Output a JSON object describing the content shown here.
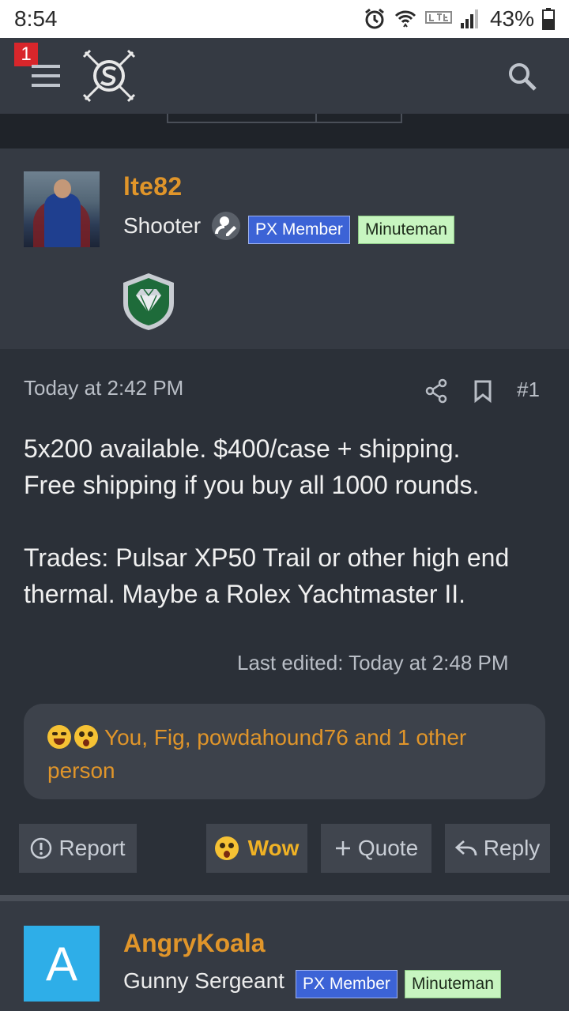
{
  "status_bar": {
    "time": "8:54",
    "battery": "43%",
    "icons": [
      "alarm-icon",
      "wifi-icon",
      "lte-icon",
      "signal-icon",
      "battery-icon"
    ]
  },
  "header": {
    "notification_count": "1",
    "icons": [
      "menu-icon",
      "site-logo",
      "search-icon"
    ]
  },
  "post1": {
    "user": {
      "name": "lte82",
      "title": "Shooter",
      "badges": [
        "PX Member",
        "Minuteman"
      ]
    },
    "date": "Today at 2:42 PM",
    "number": "#1",
    "text_lines": [
      "5x200 available. $400/case + shipping.",
      "Free shipping if you buy all 1000 rounds.",
      "Trades: Pulsar XP50 Trail or other high end",
      "thermal. Maybe a Rolex Yachtmaster II."
    ],
    "last_edited": "Last edited: Today at 2:48 PM",
    "reactions_text": "You, Fig, powdahound76 and 1 other person",
    "buttons": {
      "report": "Report",
      "wow": "Wow",
      "quote": "Quote",
      "reply": "Reply"
    }
  },
  "post2": {
    "user": {
      "avatar_letter": "A",
      "name": "AngryKoala",
      "title": "Gunny Sergeant",
      "badges": [
        "PX Member",
        "Minuteman"
      ]
    }
  },
  "colors": {
    "background": "#2b3038",
    "panel": "#353a43",
    "accent_username": "#e0952a",
    "px_badge": "#3c63d6",
    "minuteman_badge": "#c7f5c0"
  }
}
